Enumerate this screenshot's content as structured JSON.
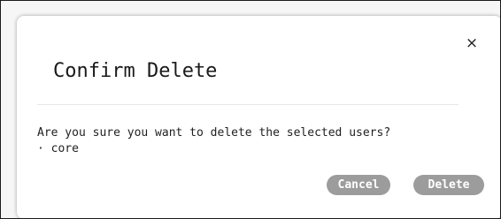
{
  "dialog": {
    "title": "Confirm Delete",
    "close_icon": "close-icon",
    "close_glyph": "×",
    "message": "Are you sure you want to delete the selected users?",
    "items": [
      "· core"
    ],
    "buttons": {
      "cancel_label": "Cancel",
      "delete_label": "Delete"
    }
  },
  "colors": {
    "button_background": "#9c9c9c",
    "button_text": "#ffffff",
    "dialog_background": "#ffffff",
    "divider": "#e6e6e6"
  }
}
